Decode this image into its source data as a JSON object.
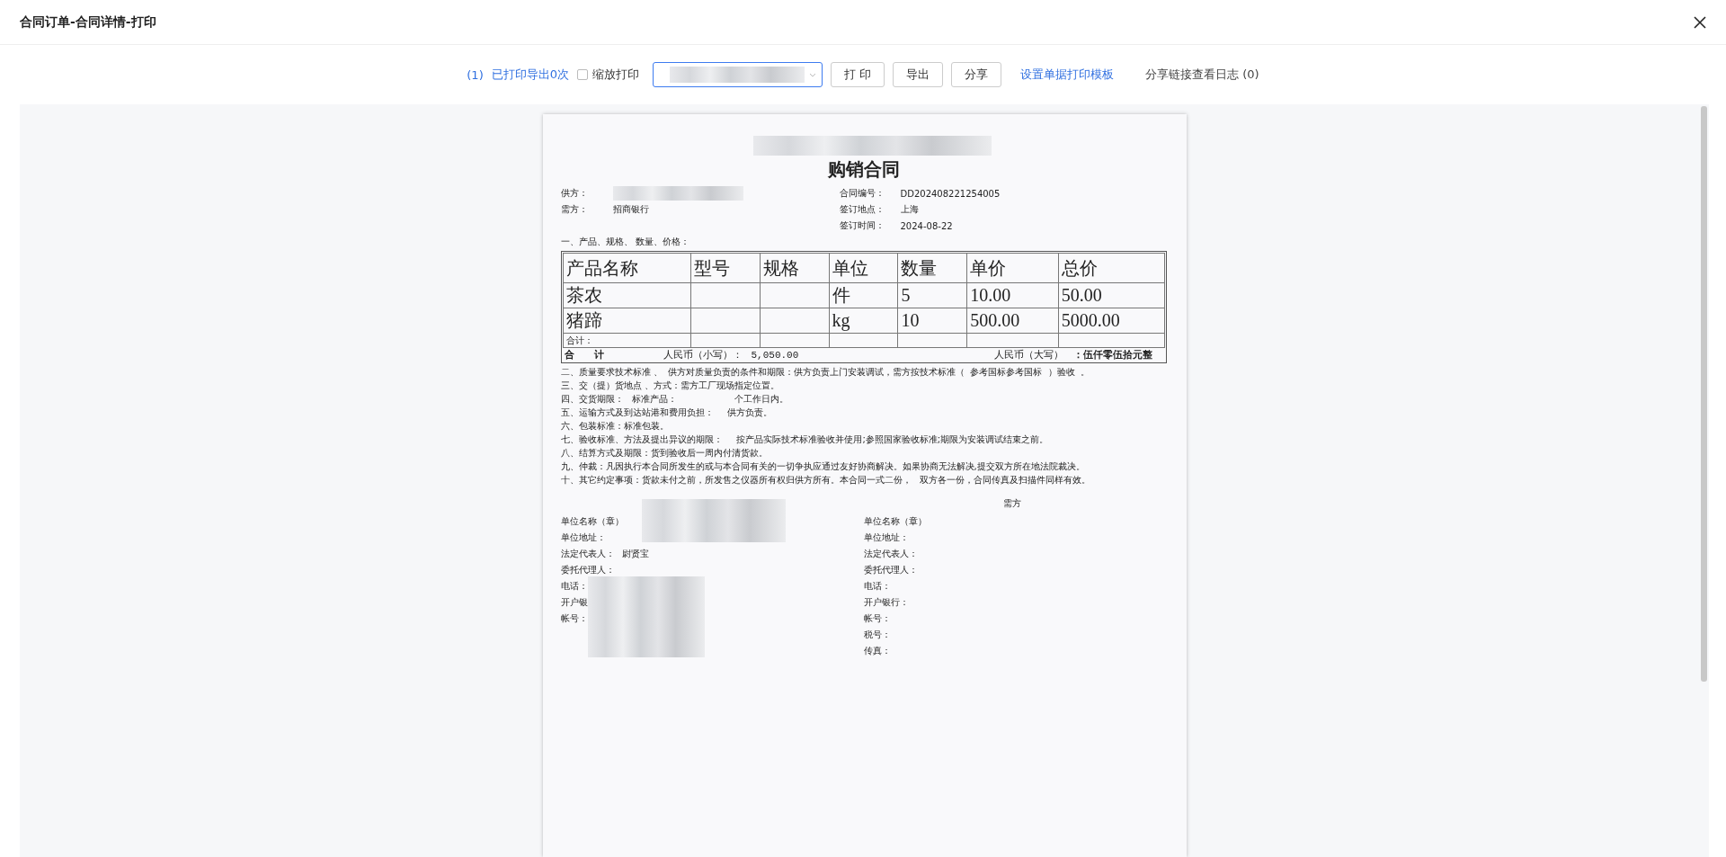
{
  "window": {
    "title": "合同订单-合同详情-打印"
  },
  "toolbar": {
    "print_count": "(1)",
    "print_status": "已打印导出0次",
    "scale_print": {
      "label": "缩放打印",
      "checked": false
    },
    "template_select": {
      "redacted": true
    },
    "buttons": [
      "打 印",
      "导出",
      "分享"
    ],
    "template_link": "设置单据打印模板",
    "share_log": "分享链接查看日志 (0)"
  },
  "document": {
    "letterhead_redacted": true,
    "title": "购销合同",
    "supplier": {
      "label": "供方：",
      "redacted": true
    },
    "buyer": {
      "label": "需方：",
      "value": "招商银行"
    },
    "info": [
      {
        "label": "合同编号：",
        "value": "DD202408221254005"
      },
      {
        "label": "签订地点：",
        "value": "上海"
      },
      {
        "label": "签订时间：",
        "value": "2024-08-22"
      }
    ],
    "section_title": "一、产品、规格、 数量、价格：",
    "table": {
      "columns": [
        "产品名称",
        "型号",
        "规格",
        "单位",
        "数量",
        "单价",
        "总价"
      ],
      "rows": [
        {
          "name": "茶农",
          "unit": "件",
          "quantity": "5",
          "unit_price": "10.00",
          "total": "50.00"
        },
        {
          "name": "猪蹄",
          "unit": "kg",
          "quantity": "10",
          "unit_price": "500.00",
          "total": "5000.00"
        }
      ],
      "subtotal_label": "合计：",
      "total": {
        "label": "合　　计",
        "small_label": "人民币（小写）：",
        "small_value": "5,050.00",
        "large_label": "人民币（大写）",
        "large_value": "：伍仟零伍拾元整"
      }
    },
    "clauses": [
      "二、质量要求技术标准 、  供方对质量负责的条件和期限：供方负责上门安装调试，需方按技术标准（  参考国标参考国标  ）验收  。",
      "三、交（提）货地点 、方式：需方工厂现场指定位置。",
      "四、交货期限：   标准产品：                    个工作日内。",
      "五、运输方式及到达站港和费用负担：     供方负责。",
      "六、包装标准：标准包装。",
      "七、验收标准、方法及提出异议的期限：     按产品实际技术标准验收并使用;参照国家验收标准;期限为安装调试结束之前。",
      "八、结算方式及期限：货到验收后一周内付清货款。",
      "九、仲裁：凡因执行本合同所发生的或与本合同有关的一切争执应通过友好协商解决。如果协商无法解决,提交双方所在地法院裁决。",
      "十、其它约定事项：货款未付之前，所发售之仪器所有权归供方所有。本合同一式二份，   双方各一份，合同传真及扫描件同样有效。"
    ],
    "signatures": {
      "left_redacted": true,
      "left": [
        {
          "label": "单位名称（章）"
        },
        {
          "label": "单位地址："
        },
        {
          "label": "法定代表人：",
          "value": "尉贤宝"
        },
        {
          "label": "委托代理人："
        },
        {
          "label": "电话："
        },
        {
          "label": "开户银"
        },
        {
          "label": "帐号："
        }
      ],
      "right_heading": "需方",
      "right": [
        {
          "label": "单位名称（章）"
        },
        {
          "label": "单位地址："
        },
        {
          "label": "法定代表人："
        },
        {
          "label": "委托代理人："
        },
        {
          "label": "电话："
        },
        {
          "label": "开户银行："
        },
        {
          "label": "帐号："
        },
        {
          "label": "税号："
        },
        {
          "label": "传真："
        }
      ]
    }
  }
}
